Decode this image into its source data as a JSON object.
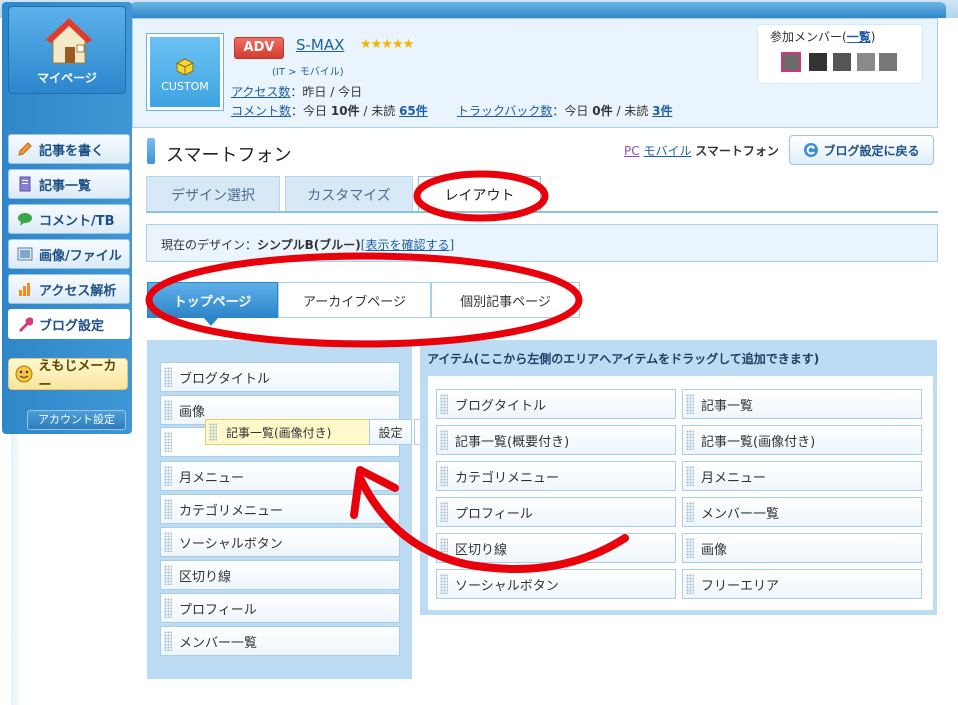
{
  "sidebar": {
    "mypage_label": "マイページ",
    "items": [
      {
        "label": "記事を書く",
        "icon": "pencil-icon"
      },
      {
        "label": "記事一覧",
        "icon": "document-icon"
      },
      {
        "label": "コメント/TB",
        "icon": "speech-bubble-icon"
      },
      {
        "label": "画像/ファイル",
        "icon": "image-icon"
      },
      {
        "label": "アクセス解析",
        "icon": "bar-chart-icon"
      },
      {
        "label": "ブログ設定",
        "icon": "wrench-icon"
      }
    ],
    "emoji_maker": "えもじメーカー",
    "account": "アカウント設定"
  },
  "blog": {
    "thumb_label": "CUSTOM",
    "adv": "ADV",
    "name": "S-MAX",
    "stars": "★★★★★",
    "category": "(IT > モバイル)",
    "access_link": "アクセス数",
    "access_text": "：昨日 / 今日",
    "comment_link": "コメント数",
    "comment_text": "：今日",
    "comment_today": "10件",
    "comment_unread_label": "/ 未読",
    "comment_unread": "65件",
    "trackback_link": "トラックバック数",
    "trackback_text": "：今日",
    "trackback_today": "0件",
    "trackback_unread_label": "/ 未読",
    "trackback_unread": "3件"
  },
  "members": {
    "label": "参加メンバー(",
    "list_link": "一覧",
    "close": ")"
  },
  "page": {
    "title": "スマートフォン",
    "device_pc": "PC",
    "device_mobile": "モバイル",
    "device_current": "スマートフォン",
    "back_button": "ブログ設定に戻る"
  },
  "tabs": [
    "デザイン選択",
    "カスタマイズ",
    "レイアウト"
  ],
  "current_design": {
    "label": "現在のデザイン：",
    "name": "シンプルB(ブルー)",
    "link": "[表示を確認する]"
  },
  "page_tabs": [
    "トップページ",
    "アーカイブページ",
    "個別記事ページ"
  ],
  "layout_slots": [
    "ブログタイトル",
    "画像",
    "",
    "月メニュー",
    "カテゴリメニュー",
    "ソーシャルボタン",
    "区切り線",
    "プロフィール",
    "メンバー一覧"
  ],
  "dragging_item": {
    "label": "記事一覧(画像付き)",
    "settings": "設定",
    "close": "✕"
  },
  "items_panel": {
    "title": "アイテム(ここから左側のエリアへアイテムをドラッグして追加できます)",
    "left_column": [
      "ブログタイトル",
      "記事一覧(概要付き)",
      "カテゴリメニュー",
      "プロフィール",
      "区切り線",
      "ソーシャルボタン"
    ],
    "right_column": [
      "記事一覧",
      "記事一覧(画像付き)",
      "月メニュー",
      "メンバー一覧",
      "画像",
      "フリーエリア"
    ]
  },
  "annotation_color": "#e8000b",
  "accent_color": "#2d85c9"
}
